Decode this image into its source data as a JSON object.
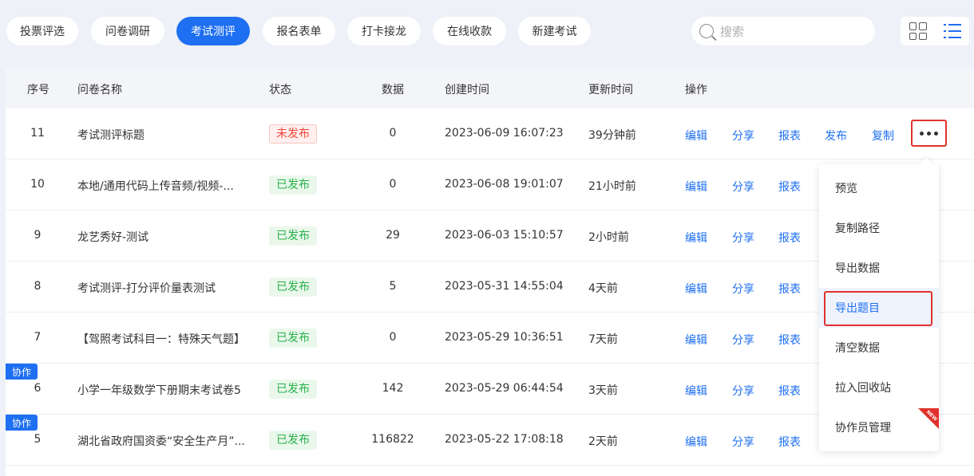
{
  "tabs": [
    {
      "label": "投票评选",
      "active": false
    },
    {
      "label": "问卷调研",
      "active": false
    },
    {
      "label": "考试测评",
      "active": true
    },
    {
      "label": "报名表单",
      "active": false
    },
    {
      "label": "打卡接龙",
      "active": false
    },
    {
      "label": "在线收款",
      "active": false
    },
    {
      "label": "新建考试",
      "active": false
    }
  ],
  "search": {
    "placeholder": "搜索"
  },
  "view_toggle": {
    "grid_icon": "grid-icon",
    "list_icon": "list-icon",
    "active": "list"
  },
  "table": {
    "headers": [
      "序号",
      "问卷名称",
      "状态",
      "数据",
      "创建时间",
      "更新时间",
      "操作"
    ],
    "rows": [
      {
        "no": "11",
        "name": "考试测评标题",
        "status": "未发布",
        "status_type": "draft",
        "count": "0",
        "created": "2023-06-09 16:07:23",
        "updated": "39分钟前",
        "collab": ""
      },
      {
        "no": "10",
        "name": "本地/通用代码上传音频/视频-...",
        "status": "已发布",
        "status_type": "published",
        "count": "0",
        "created": "2023-06-08 19:01:07",
        "updated": "21小时前",
        "collab": ""
      },
      {
        "no": "9",
        "name": "龙艺秀好-测试",
        "status": "已发布",
        "status_type": "published",
        "count": "29",
        "created": "2023-06-03 15:10:57",
        "updated": "2小时前",
        "collab": ""
      },
      {
        "no": "8",
        "name": "考试测评-打分评价量表测试",
        "status": "已发布",
        "status_type": "published",
        "count": "5",
        "created": "2023-05-31 14:55:04",
        "updated": "4天前",
        "collab": ""
      },
      {
        "no": "7",
        "name": "【驾照考试科目一：特殊天气题】",
        "status": "已发布",
        "status_type": "published",
        "count": "0",
        "created": "2023-05-29 10:36:51",
        "updated": "7天前",
        "collab": ""
      },
      {
        "no": "6",
        "name": "小学一年级数学下册期末考试卷5",
        "status": "已发布",
        "status_type": "published",
        "count": "142",
        "created": "2023-05-29 06:44:54",
        "updated": "3天前",
        "collab": "协作"
      },
      {
        "no": "5",
        "name": "湖北省政府国资委“安全生产月”...",
        "status": "已发布",
        "status_type": "published",
        "count": "116822",
        "created": "2023-05-22 17:08:18",
        "updated": "2天前",
        "collab": "协作"
      }
    ],
    "actions_full": [
      "编辑",
      "分享",
      "报表",
      "发布",
      "复制"
    ],
    "actions_short": [
      "编辑",
      "分享",
      "报表"
    ]
  },
  "more_menu": {
    "items": [
      "预览",
      "复制路径",
      "导出数据",
      "导出题目",
      "清空数据",
      "拉入回收站",
      "协作员管理"
    ],
    "highlighted_index": 3,
    "new_badge": "NEW"
  },
  "colors": {
    "accent": "#1e6ff1",
    "danger": "#e0322c",
    "success": "#27b14a"
  }
}
